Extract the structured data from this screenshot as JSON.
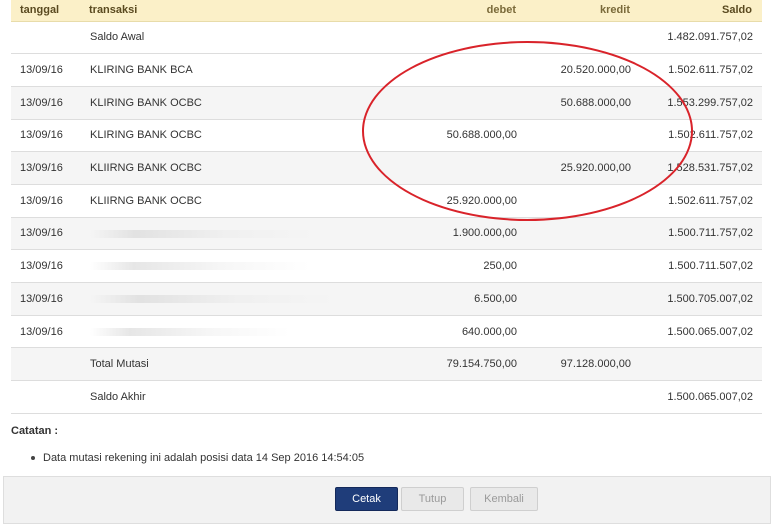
{
  "table": {
    "headers": [
      "tanggal",
      "transaksi",
      "debet",
      "kredit",
      "Saldo"
    ],
    "rows": [
      {
        "date": "",
        "desc": "Saldo Awal",
        "debet": "",
        "kredit": "",
        "saldo": "1.482.091.757,02"
      },
      {
        "date": "13/09/16",
        "desc": "KLIRING BANK BCA",
        "debet": "",
        "kredit": "20.520.000,00",
        "saldo": "1.502.611.757,02"
      },
      {
        "date": "13/09/16",
        "desc": "KLIRING BANK OCBC",
        "debet": "",
        "kredit": "50.688.000,00",
        "saldo": "1.553.299.757,02"
      },
      {
        "date": "13/09/16",
        "desc": "KLIRING BANK OCBC",
        "debet": "50.688.000,00",
        "kredit": "",
        "saldo": "1.502.611.757,02"
      },
      {
        "date": "13/09/16",
        "desc": "KLIIRNG BANK OCBC",
        "debet": "",
        "kredit": "25.920.000,00",
        "saldo": "1.528.531.757,02"
      },
      {
        "date": "13/09/16",
        "desc": "KLIIRNG BANK OCBC",
        "debet": "25.920.000,00",
        "kredit": "",
        "saldo": "1.502.611.757,02"
      },
      {
        "date": "13/09/16",
        "desc": "",
        "debet": "1.900.000,00",
        "kredit": "",
        "saldo": "1.500.711.757,02"
      },
      {
        "date": "13/09/16",
        "desc": "",
        "debet": "250,00",
        "kredit": "",
        "saldo": "1.500.711.507,02"
      },
      {
        "date": "13/09/16",
        "desc": "",
        "debet": "6.500,00",
        "kredit": "",
        "saldo": "1.500.705.007,02"
      },
      {
        "date": "13/09/16",
        "desc": "",
        "debet": "640.000,00",
        "kredit": "",
        "saldo": "1.500.065.007,02"
      },
      {
        "date": "",
        "desc": "Total Mutasi",
        "debet": "79.154.750,00",
        "kredit": "97.128.000,00",
        "saldo": ""
      },
      {
        "date": "",
        "desc": "Saldo Akhir",
        "debet": "",
        "kredit": "",
        "saldo": "1.500.065.007,02"
      }
    ]
  },
  "notes": {
    "title": "Catatan :",
    "items": [
      "Data mutasi rekening ini adalah posisi data 14 Sep 2016 14:54:05"
    ]
  },
  "buttons": {
    "cetak": "Cetak",
    "tutup": "Tutup",
    "kembali": "Kembali"
  },
  "colors": {
    "header_bg": "#fbf0c8",
    "primary_button": "#1f3d7a",
    "annotation": "#d9232a"
  }
}
